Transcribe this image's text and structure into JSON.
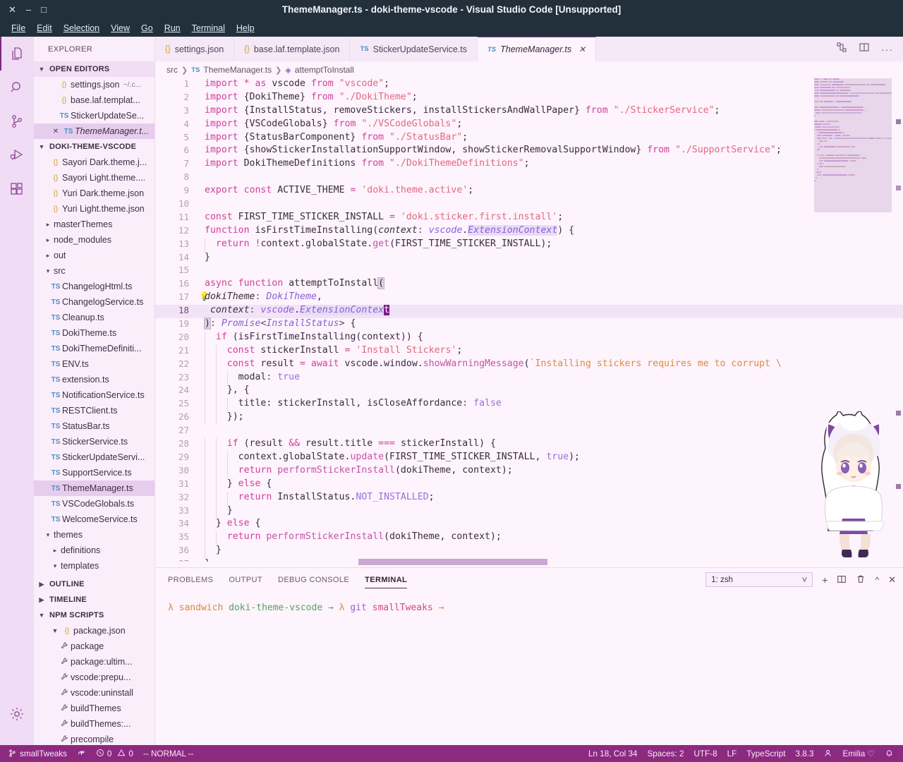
{
  "window": {
    "title": "ThemeManager.ts - doki-theme-vscode - Visual Studio Code [Unsupported]",
    "controls": {
      "close": "✕",
      "minimize": "–",
      "maximize": "□"
    }
  },
  "menubar": [
    {
      "label": "File"
    },
    {
      "label": "Edit"
    },
    {
      "label": "Selection"
    },
    {
      "label": "View"
    },
    {
      "label": "Go"
    },
    {
      "label": "Run"
    },
    {
      "label": "Terminal"
    },
    {
      "label": "Help"
    }
  ],
  "activitybar": [
    {
      "name": "explorer",
      "icon": "files-icon"
    },
    {
      "name": "search",
      "icon": "search-icon"
    },
    {
      "name": "source-control",
      "icon": "source-control-icon"
    },
    {
      "name": "run-debug",
      "icon": "run-debug-icon"
    },
    {
      "name": "extensions",
      "icon": "extensions-icon"
    },
    {
      "name": "manage",
      "icon": "gear-icon"
    }
  ],
  "sidebar": {
    "title": "EXPLORER",
    "open_editors": {
      "label": "OPEN EDITORS",
      "items": [
        {
          "icon": "json",
          "label": "settings.json",
          "sub": "~/.c...",
          "selected": false,
          "dirty": false
        },
        {
          "icon": "json",
          "label": "base.laf.templat...",
          "sub": "",
          "selected": false,
          "dirty": false
        },
        {
          "icon": "ts",
          "label": "StickerUpdateSe...",
          "sub": "",
          "selected": false,
          "dirty": false
        },
        {
          "icon": "ts",
          "label": "ThemeManager.t...",
          "sub": "",
          "selected": true,
          "dirty": false
        }
      ]
    },
    "project": {
      "label": "DOKI-THEME-VSCODE",
      "items": [
        {
          "icon": "json",
          "label": "Sayori Dark.theme.j...",
          "indent": 2
        },
        {
          "icon": "json",
          "label": "Sayori Light.theme....",
          "indent": 2
        },
        {
          "icon": "json",
          "label": "Yuri Dark.theme.json",
          "indent": 2
        },
        {
          "icon": "json",
          "label": "Yuri Light.theme.json",
          "indent": 2
        },
        {
          "icon": "folder-collapsed",
          "label": "masterThemes",
          "indent": 1
        },
        {
          "icon": "folder-collapsed",
          "label": "node_modules",
          "indent": 1
        },
        {
          "icon": "folder-collapsed",
          "label": "out",
          "indent": 1
        },
        {
          "icon": "folder-expanded",
          "label": "src",
          "indent": 1
        },
        {
          "icon": "ts",
          "label": "ChangelogHtml.ts",
          "indent": 2
        },
        {
          "icon": "ts",
          "label": "ChangelogService.ts",
          "indent": 2
        },
        {
          "icon": "ts",
          "label": "Cleanup.ts",
          "indent": 2
        },
        {
          "icon": "ts",
          "label": "DokiTheme.ts",
          "indent": 2
        },
        {
          "icon": "ts",
          "label": "DokiThemeDefiniti...",
          "indent": 2
        },
        {
          "icon": "ts",
          "label": "ENV.ts",
          "indent": 2
        },
        {
          "icon": "ts",
          "label": "extension.ts",
          "indent": 2
        },
        {
          "icon": "ts",
          "label": "NotificationService.ts",
          "indent": 2
        },
        {
          "icon": "ts",
          "label": "RESTClient.ts",
          "indent": 2
        },
        {
          "icon": "ts",
          "label": "StatusBar.ts",
          "indent": 2
        },
        {
          "icon": "ts",
          "label": "StickerService.ts",
          "indent": 2
        },
        {
          "icon": "ts",
          "label": "StickerUpdateServi...",
          "indent": 2
        },
        {
          "icon": "ts",
          "label": "SupportService.ts",
          "indent": 2
        },
        {
          "icon": "ts",
          "label": "ThemeManager.ts",
          "indent": 2,
          "selected": true
        },
        {
          "icon": "ts",
          "label": "VSCodeGlobals.ts",
          "indent": 2
        },
        {
          "icon": "ts",
          "label": "WelcomeService.ts",
          "indent": 2
        },
        {
          "icon": "folder-expanded",
          "label": "themes",
          "indent": 1
        },
        {
          "icon": "folder-collapsed",
          "label": "definitions",
          "indent": 2
        },
        {
          "icon": "folder-expanded",
          "label": "templates",
          "indent": 2
        }
      ]
    },
    "outline": {
      "label": "OUTLINE"
    },
    "timeline": {
      "label": "TIMELINE"
    },
    "npm_scripts": {
      "label": "NPM SCRIPTS",
      "package_label": "package.json",
      "scripts": [
        {
          "label": "package"
        },
        {
          "label": "package:ultim..."
        },
        {
          "label": "vscode:prepu..."
        },
        {
          "label": "vscode:uninstall"
        },
        {
          "label": "buildThemes"
        },
        {
          "label": "buildThemes:..."
        },
        {
          "label": "precompile"
        }
      ]
    }
  },
  "tabs": [
    {
      "icon": "json",
      "label": "settings.json",
      "active": false
    },
    {
      "icon": "json",
      "label": "base.laf.template.json",
      "active": false
    },
    {
      "icon": "ts",
      "label": "StickerUpdateService.ts",
      "active": false
    },
    {
      "icon": "ts",
      "label": "ThemeManager.ts",
      "active": true,
      "close": "✕"
    }
  ],
  "editor_actions": [
    {
      "name": "split-changes-icon"
    },
    {
      "name": "split-editor-icon"
    },
    {
      "name": "more-actions-icon",
      "label": "···"
    }
  ],
  "breadcrumb": [
    {
      "label": "src",
      "icon": ""
    },
    {
      "label": "ThemeManager.ts",
      "icon": "ts"
    },
    {
      "label": "attemptToInstall",
      "icon": "symbol-method"
    }
  ],
  "code": {
    "first_line": 1,
    "lines": [
      {
        "n": 1,
        "html": "<span class='kw'>import</span> <span class='op'>*</span> <span class='kw'>as</span> vscode <span class='kw'>from</span> <span class='str'>\"vscode\"</span>;"
      },
      {
        "n": 2,
        "html": "<span class='kw'>import</span> {DokiTheme} <span class='kw'>from</span> <span class='str'>\"./DokiTheme\"</span>;"
      },
      {
        "n": 3,
        "html": "<span class='kw'>import</span> {InstallStatus, removeStickers, installStickersAndWallPaper} <span class='kw'>from</span> <span class='str'>\"./StickerService\"</span>;"
      },
      {
        "n": 4,
        "html": "<span class='kw'>import</span> {VSCodeGlobals} <span class='kw'>from</span> <span class='str'>\"./VSCodeGlobals\"</span>;"
      },
      {
        "n": 5,
        "html": "<span class='kw'>import</span> {StatusBarComponent} <span class='kw'>from</span> <span class='str'>\"./StatusBar\"</span>;"
      },
      {
        "n": 6,
        "html": "<span class='kw'>import</span> {showStickerInstallationSupportWindow, showStickerRemovalSupportWindow} <span class='kw'>from</span> <span class='str'>\"./SupportService\"</span>;"
      },
      {
        "n": 7,
        "html": "<span class='kw'>import</span> DokiThemeDefinitions <span class='kw'>from</span> <span class='str'>\"./DokiThemeDefinitions\"</span>;"
      },
      {
        "n": 8,
        "html": ""
      },
      {
        "n": 9,
        "html": "<span class='kw'>export</span> <span class='kw'>const</span> ACTIVE_THEME <span class='op'>=</span> <span class='str'>'doki.theme.active'</span>;"
      },
      {
        "n": 10,
        "html": ""
      },
      {
        "n": 11,
        "html": "<span class='kw'>const</span> FIRST_TIME_STICKER_INSTALL <span class='op'>=</span> <span class='str'>'doki.sticker.first.install'</span>;"
      },
      {
        "n": 12,
        "html": "<span class='kw'>function</span> isFirstTimeInstalling(<span class='param'>context</span><span class='punct'>:</span> <span class='type'>vscode</span>.<span class='type hl-type'>ExtensionContext</span>) {"
      },
      {
        "n": 13,
        "html": "  <span class='kw'>return</span> <span class='op'>!</span>context.globalState.<span class='fn'>get</span>(FIRST_TIME_STICKER_INSTALL);"
      },
      {
        "n": 14,
        "html": "}"
      },
      {
        "n": 15,
        "html": ""
      },
      {
        "n": 16,
        "html": "<span class='kw'>async</span> <span class='kw'>function</span> attemptToInstall<span class='brkt-match'>(</span>"
      },
      {
        "n": 17,
        "html": "<span class='param'>dokiTheme</span><span class='punct'>:</span> <span class='type'>DokiTheme</span>,",
        "bulb": true
      },
      {
        "n": 18,
        "html": " <span class='param'>context</span><span class='punct'>:</span> <span class='type'>vscode</span>.<span class='type hl-type'>ExtensionContex</span><span class='cursor'>t</span>",
        "current": true
      },
      {
        "n": 19,
        "html": "<span class='brkt-match'>)</span><span class='punct'>:</span> <span class='type'>Promise</span><span class='punct'>&lt;</span><span class='type'>InstallStatus</span><span class='punct'>&gt;</span> {"
      },
      {
        "n": 20,
        "html": "  <span class='kw'>if</span> (isFirstTimeInstalling(context)) {"
      },
      {
        "n": 21,
        "html": "    <span class='kw'>const</span> stickerInstall <span class='op'>=</span> <span class='str'>'Install Stickers'</span>;"
      },
      {
        "n": 22,
        "html": "    <span class='kw'>const</span> result <span class='op'>=</span> <span class='kw'>await</span> vscode.window.<span class='fn'>showWarningMessage</span>(<span class='tmpl'>`Installing stickers requires me to corrupt \\</span>"
      },
      {
        "n": 23,
        "html": "      modal<span class='punct'>:</span> <span class='const'>true</span>"
      },
      {
        "n": 24,
        "html": "    }, {"
      },
      {
        "n": 25,
        "html": "      title: stickerInstall, isCloseAffordance<span class='punct'>:</span> <span class='const'>false</span>"
      },
      {
        "n": 26,
        "html": "    });"
      },
      {
        "n": 27,
        "html": ""
      },
      {
        "n": 28,
        "html": "    <span class='kw'>if</span> (result <span class='op'>&amp;&amp;</span> result.title <span class='op'>===</span> stickerInstall) {"
      },
      {
        "n": 29,
        "html": "      context.globalState.<span class='fn'>update</span>(FIRST_TIME_STICKER_INSTALL, <span class='const'>true</span>);"
      },
      {
        "n": 30,
        "html": "      <span class='kw'>return</span> <span class='fn'>performStickerInstall</span>(dokiTheme, context);"
      },
      {
        "n": 31,
        "html": "    } <span class='kw'>else</span> {"
      },
      {
        "n": 32,
        "html": "      <span class='kw'>return</span> InstallStatus.<span class='const'>NOT_INSTALLED</span>;"
      },
      {
        "n": 33,
        "html": "    }"
      },
      {
        "n": 34,
        "html": "  } <span class='kw'>else</span> {"
      },
      {
        "n": 35,
        "html": "    <span class='kw'>return</span> <span class='fn'>performStickerInstall</span>(dokiTheme, context);"
      },
      {
        "n": 36,
        "html": "  }"
      },
      {
        "n": 37,
        "html": "}"
      }
    ]
  },
  "panel": {
    "tabs": [
      {
        "label": "PROBLEMS",
        "active": false
      },
      {
        "label": "OUTPUT",
        "active": false
      },
      {
        "label": "DEBUG CONSOLE",
        "active": false
      },
      {
        "label": "TERMINAL",
        "active": true
      }
    ],
    "terminal_select": {
      "value": "1: zsh",
      "chevron": "⌄"
    },
    "actions": [
      {
        "name": "new-terminal-icon",
        "glyph": "＋"
      },
      {
        "name": "split-terminal-icon",
        "glyph": "◫"
      },
      {
        "name": "kill-terminal-icon",
        "glyph": "Ὕ1"
      },
      {
        "name": "maximize-panel-icon",
        "glyph": "⌃"
      },
      {
        "name": "close-panel-icon",
        "glyph": "✕"
      }
    ],
    "terminal_line": {
      "lambda1": "λ",
      "user": "sandwich",
      "dir": "doki-theme-vscode",
      "arrow1": "→",
      "lambda2": "λ",
      "git": "git",
      "branch": "smallTweaks",
      "arrow2": "→"
    }
  },
  "statusbar": {
    "left": [
      {
        "name": "branch",
        "icon": "source-control-icon",
        "label": "smallTweaks"
      },
      {
        "name": "sync",
        "icon": "sync-icon",
        "label": ""
      },
      {
        "name": "problems",
        "icon": "error-warning-icon",
        "label": "0  0",
        "errors": "0",
        "warnings": "0"
      },
      {
        "name": "vim-mode",
        "icon": "",
        "label": "-- NORMAL --"
      }
    ],
    "right": [
      {
        "name": "cursor-position",
        "label": "Ln 18, Col 34"
      },
      {
        "name": "indentation",
        "label": "Spaces: 2"
      },
      {
        "name": "encoding",
        "label": "UTF-8"
      },
      {
        "name": "eol",
        "label": "LF"
      },
      {
        "name": "language-mode",
        "label": "TypeScript"
      },
      {
        "name": "ts-version",
        "label": "3.8.3"
      },
      {
        "name": "remote-indicator",
        "label": "",
        "icon": "account-icon"
      },
      {
        "name": "doki-theme",
        "label": "Emilia ♡"
      },
      {
        "name": "notifications",
        "label": "",
        "icon": "bell-icon"
      }
    ]
  },
  "colors": {
    "titlebar_bg": "#22303c",
    "activitybar_bg": "#f0dcf4",
    "sidebar_bg": "#fbeefb",
    "editor_bg": "#fdf4fd",
    "statusbar_bg": "#8c2a80",
    "accent": "#9c3f9e",
    "cursor": "#7b1d8a"
  }
}
